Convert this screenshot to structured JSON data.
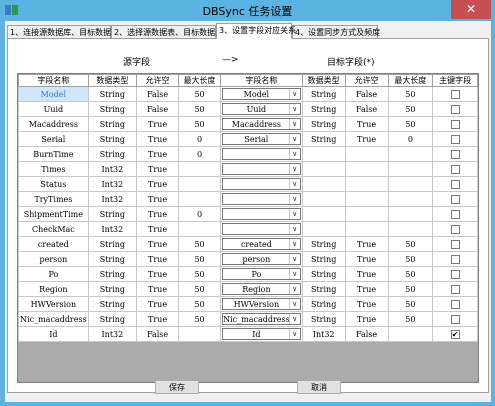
{
  "window": {
    "title": "DBSync 任务设置",
    "close_glyph": "✕"
  },
  "tabs": [
    {
      "label": "1、连接源数据库、目标数据库",
      "active": false
    },
    {
      "label": "2、选择源数据表、目标数据表",
      "active": false
    },
    {
      "label": "3、设置字段对应关系",
      "active": true
    },
    {
      "label": "4、设置同步方式及频度",
      "active": false
    }
  ],
  "mapping": {
    "source_label": "源字段",
    "arrow": "—>",
    "target_label": "目标字段(*)"
  },
  "grid": {
    "columns": [
      "字段名称",
      "数据类型",
      "允许空",
      "最大长度",
      "字段名称",
      "数据类型",
      "允许空",
      "最大长度",
      "主键字段"
    ],
    "rows": [
      {
        "src_name": "Model",
        "src_type": "String",
        "src_null": "False",
        "src_len": "50",
        "dst_name": "Model",
        "dst_type": "String",
        "dst_null": "False",
        "dst_len": "50",
        "pk": false
      },
      {
        "src_name": "Uuid",
        "src_type": "String",
        "src_null": "False",
        "src_len": "50",
        "dst_name": "Uuid",
        "dst_type": "String",
        "dst_null": "False",
        "dst_len": "50",
        "pk": false
      },
      {
        "src_name": "Macaddress",
        "src_type": "String",
        "src_null": "True",
        "src_len": "50",
        "dst_name": "Macaddress",
        "dst_type": "String",
        "dst_null": "True",
        "dst_len": "50",
        "pk": false
      },
      {
        "src_name": "Serial",
        "src_type": "String",
        "src_null": "True",
        "src_len": "0",
        "dst_name": "Serial",
        "dst_type": "String",
        "dst_null": "True",
        "dst_len": "0",
        "pk": false
      },
      {
        "src_name": "BurnTime",
        "src_type": "String",
        "src_null": "True",
        "src_len": "0",
        "dst_name": "",
        "dst_type": "",
        "dst_null": "",
        "dst_len": "",
        "pk": false
      },
      {
        "src_name": "Times",
        "src_type": "Int32",
        "src_null": "True",
        "src_len": "",
        "dst_name": "",
        "dst_type": "",
        "dst_null": "",
        "dst_len": "",
        "pk": false
      },
      {
        "src_name": "Status",
        "src_type": "Int32",
        "src_null": "True",
        "src_len": "",
        "dst_name": "",
        "dst_type": "",
        "dst_null": "",
        "dst_len": "",
        "pk": false
      },
      {
        "src_name": "TryTimes",
        "src_type": "Int32",
        "src_null": "True",
        "src_len": "",
        "dst_name": "",
        "dst_type": "",
        "dst_null": "",
        "dst_len": "",
        "pk": false
      },
      {
        "src_name": "ShipmentTime",
        "src_type": "String",
        "src_null": "True",
        "src_len": "0",
        "dst_name": "",
        "dst_type": "",
        "dst_null": "",
        "dst_len": "",
        "pk": false
      },
      {
        "src_name": "CheckMac",
        "src_type": "Int32",
        "src_null": "True",
        "src_len": "",
        "dst_name": "",
        "dst_type": "",
        "dst_null": "",
        "dst_len": "",
        "pk": false
      },
      {
        "src_name": "created",
        "src_type": "String",
        "src_null": "True",
        "src_len": "50",
        "dst_name": "created",
        "dst_type": "String",
        "dst_null": "True",
        "dst_len": "50",
        "pk": false
      },
      {
        "src_name": "person",
        "src_type": "String",
        "src_null": "True",
        "src_len": "50",
        "dst_name": "person",
        "dst_type": "String",
        "dst_null": "True",
        "dst_len": "50",
        "pk": false
      },
      {
        "src_name": "Po",
        "src_type": "String",
        "src_null": "True",
        "src_len": "50",
        "dst_name": "Po",
        "dst_type": "String",
        "dst_null": "True",
        "dst_len": "50",
        "pk": false
      },
      {
        "src_name": "Region",
        "src_type": "String",
        "src_null": "True",
        "src_len": "50",
        "dst_name": "Region",
        "dst_type": "String",
        "dst_null": "True",
        "dst_len": "50",
        "pk": false
      },
      {
        "src_name": "HWVersion",
        "src_type": "String",
        "src_null": "True",
        "src_len": "50",
        "dst_name": "HWVersion",
        "dst_type": "String",
        "dst_null": "True",
        "dst_len": "50",
        "pk": false
      },
      {
        "src_name": "Nic_macaddress",
        "src_type": "String",
        "src_null": "True",
        "src_len": "50",
        "dst_name": "Nic_macaddress",
        "dst_type": "String",
        "dst_null": "True",
        "dst_len": "50",
        "pk": false
      },
      {
        "src_name": "Id",
        "src_type": "Int32",
        "src_null": "False",
        "src_len": "",
        "dst_name": "Id",
        "dst_type": "Int32",
        "dst_null": "False",
        "dst_len": "",
        "pk": true
      }
    ]
  },
  "buttons": {
    "save": "保存",
    "cancel": "取消"
  },
  "icons": {
    "dropdown": "chevron-down-icon",
    "checked": "✔"
  }
}
